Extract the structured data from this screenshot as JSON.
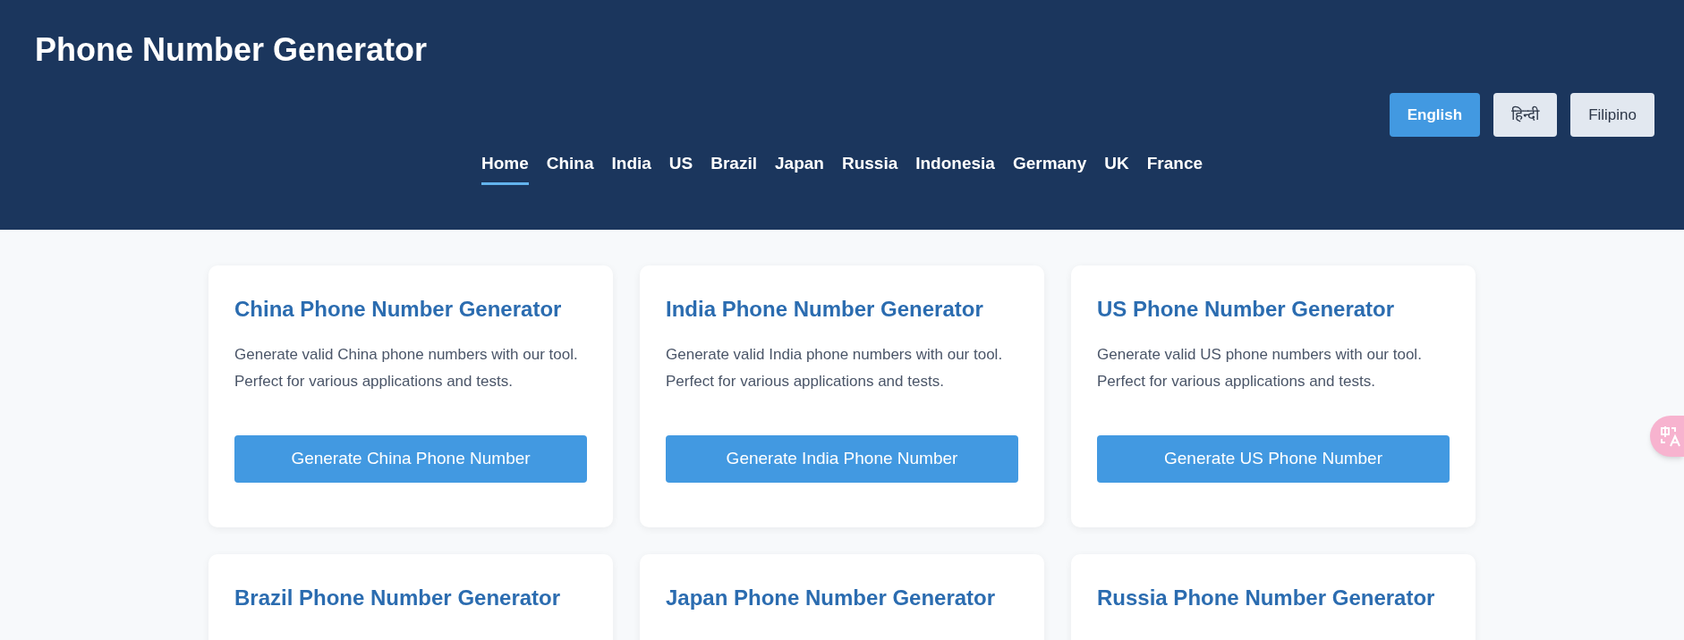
{
  "header": {
    "title": "Phone Number Generator"
  },
  "languages": [
    {
      "label": "English",
      "selected": true
    },
    {
      "label": "हिन्दी",
      "selected": false
    },
    {
      "label": "Filipino",
      "selected": false
    }
  ],
  "nav": [
    {
      "label": "Home",
      "selected": true
    },
    {
      "label": "China",
      "selected": false
    },
    {
      "label": "India",
      "selected": false
    },
    {
      "label": "US",
      "selected": false
    },
    {
      "label": "Brazil",
      "selected": false
    },
    {
      "label": "Japan",
      "selected": false
    },
    {
      "label": "Russia",
      "selected": false
    },
    {
      "label": "Indonesia",
      "selected": false
    },
    {
      "label": "Germany",
      "selected": false
    },
    {
      "label": "UK",
      "selected": false
    },
    {
      "label": "France",
      "selected": false
    }
  ],
  "cards": [
    {
      "title": "China Phone Number Generator",
      "description": "Generate valid China phone numbers with our tool. Perfect for various applications and tests.",
      "button": "Generate China Phone Number"
    },
    {
      "title": "India Phone Number Generator",
      "description": "Generate valid India phone numbers with our tool. Perfect for various applications and tests.",
      "button": "Generate India Phone Number"
    },
    {
      "title": "US Phone Number Generator",
      "description": "Generate valid US phone numbers with our tool. Perfect for various applications and tests.",
      "button": "Generate US Phone Number"
    },
    {
      "title": "Brazil Phone Number Generator"
    },
    {
      "title": "Japan Phone Number Generator"
    },
    {
      "title": "Russia Phone Number Generator"
    }
  ]
}
